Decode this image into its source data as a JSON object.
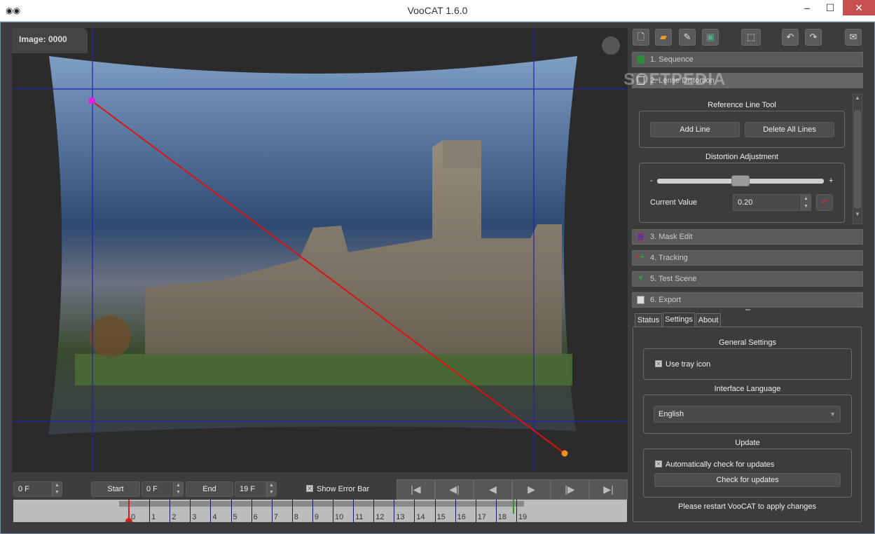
{
  "window": {
    "title": "VooCAT 1.6.0",
    "minimize": "–",
    "maximize": "☐",
    "close": "✕"
  },
  "viewer": {
    "image_label": "Image: 0000",
    "watermark": "SOFTPEDIA"
  },
  "toolbar": [
    "new-file",
    "open-folder",
    "edit",
    "save",
    "select-region",
    "undo",
    "redo",
    "feedback"
  ],
  "sections": [
    {
      "label": "1. Sequence",
      "icon": "sequence-icon",
      "color": "#2e8b3c"
    },
    {
      "label": "2. Lense Distortion",
      "icon": "distortion-icon",
      "color": "#cccccc"
    },
    {
      "label": "3. Mask Edit",
      "icon": "mask-icon",
      "color": "#5b3b8c"
    },
    {
      "label": "4. Tracking",
      "icon": "tracking-icon",
      "color": "#c03030"
    },
    {
      "label": "5. Test Scene",
      "icon": "test-scene-icon",
      "color": "#3a9a3a"
    },
    {
      "label": "6. Export",
      "icon": "export-icon",
      "color": "#dddddd"
    }
  ],
  "lens": {
    "reference_title": "Reference Line Tool",
    "add_line": "Add Line",
    "delete_all": "Delete All Lines",
    "distortion_title": "Distortion Adjustment",
    "minus": "-",
    "plus": "+",
    "current_value_label": "Current Value",
    "current_value": "0.20",
    "slider_value": 0.5
  },
  "tabs": {
    "status": "Status",
    "settings": "Settings",
    "about": "About",
    "active": "settings"
  },
  "settings": {
    "general_title": "General Settings",
    "tray_label": "Use tray icon",
    "tray_checked": true,
    "language_title": "Interface Language",
    "language_value": "English",
    "update_title": "Update",
    "auto_check_label": "Automatically check for updates",
    "auto_check_checked": true,
    "check_button": "Check for updates",
    "restart_note": "Please restart VooCAT to apply changes"
  },
  "bottom": {
    "frame_field": "0 F",
    "start_label": "Start",
    "start_value": "0 F",
    "end_label": "End",
    "end_value": "19 F",
    "show_error_bar": "Show Error Bar",
    "show_error_checked": true
  },
  "timeline": {
    "ticks": [
      "0",
      "1",
      "2",
      "3",
      "4",
      "5",
      "6",
      "7",
      "8",
      "9",
      "10",
      "11",
      "12",
      "13",
      "14",
      "15",
      "16",
      "17",
      "18",
      "19"
    ],
    "start": 0,
    "end": 19
  }
}
